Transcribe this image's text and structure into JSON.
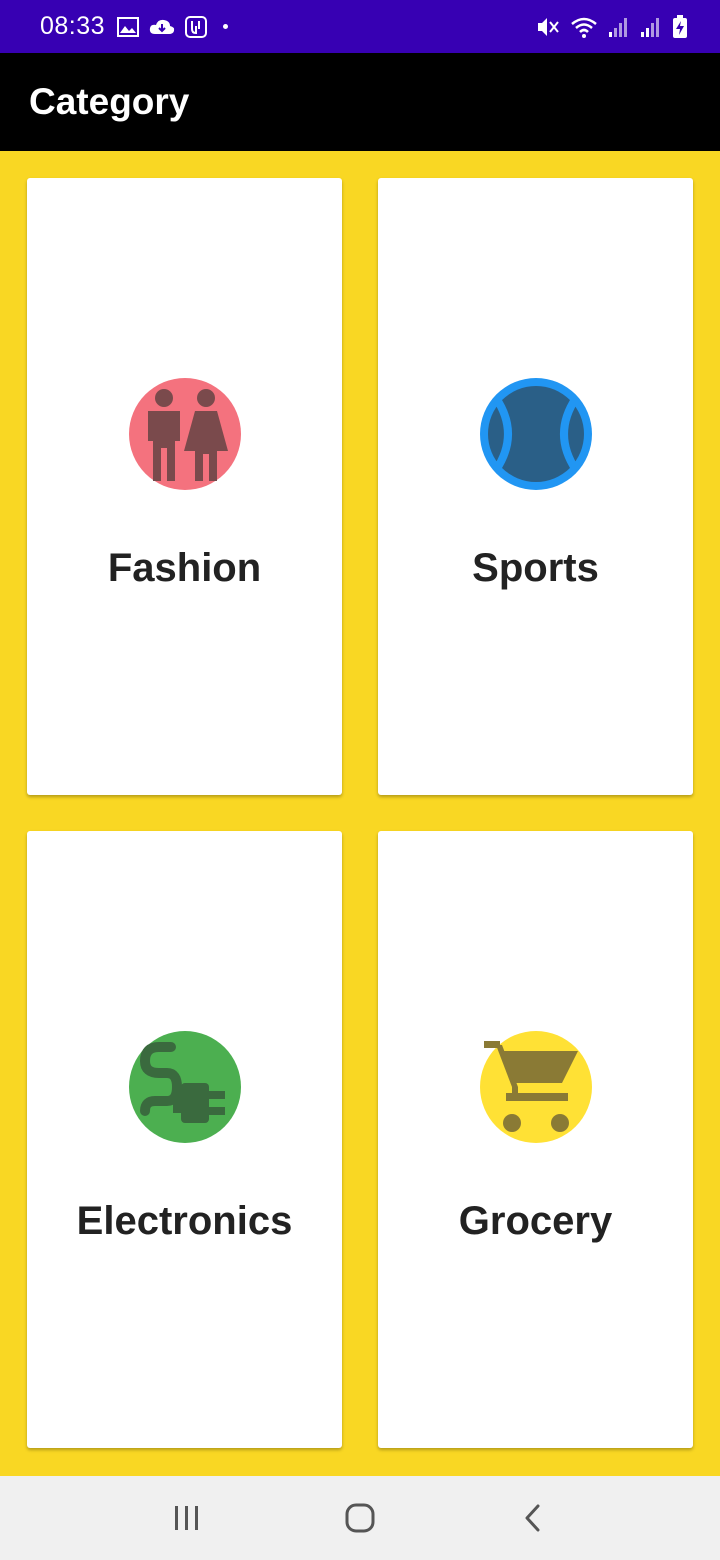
{
  "status_bar": {
    "time": "08:33",
    "icons": [
      "image-icon",
      "cloud-download-icon",
      "app-notification-icon",
      "mute-icon",
      "wifi-icon",
      "signal-icon",
      "signal-icon",
      "battery-charging-icon"
    ]
  },
  "app_bar": {
    "title": "Category"
  },
  "categories": [
    {
      "label": "Fashion",
      "icon": "fashion-icon",
      "color": "#F4727E"
    },
    {
      "label": "Sports",
      "icon": "ball-icon",
      "color": "#2196F3"
    },
    {
      "label": "Electronics",
      "icon": "plug-icon",
      "color": "#4CAF50"
    },
    {
      "label": "Grocery",
      "icon": "cart-icon",
      "color": "#FFE135"
    }
  ],
  "colors": {
    "background": "#F9D723",
    "status_bar": "#3700B3",
    "app_bar": "#000000",
    "nav_bar": "#F0F0F0"
  },
  "nav_bar": {
    "buttons": [
      "recent-apps-icon",
      "home-icon",
      "back-icon"
    ]
  }
}
